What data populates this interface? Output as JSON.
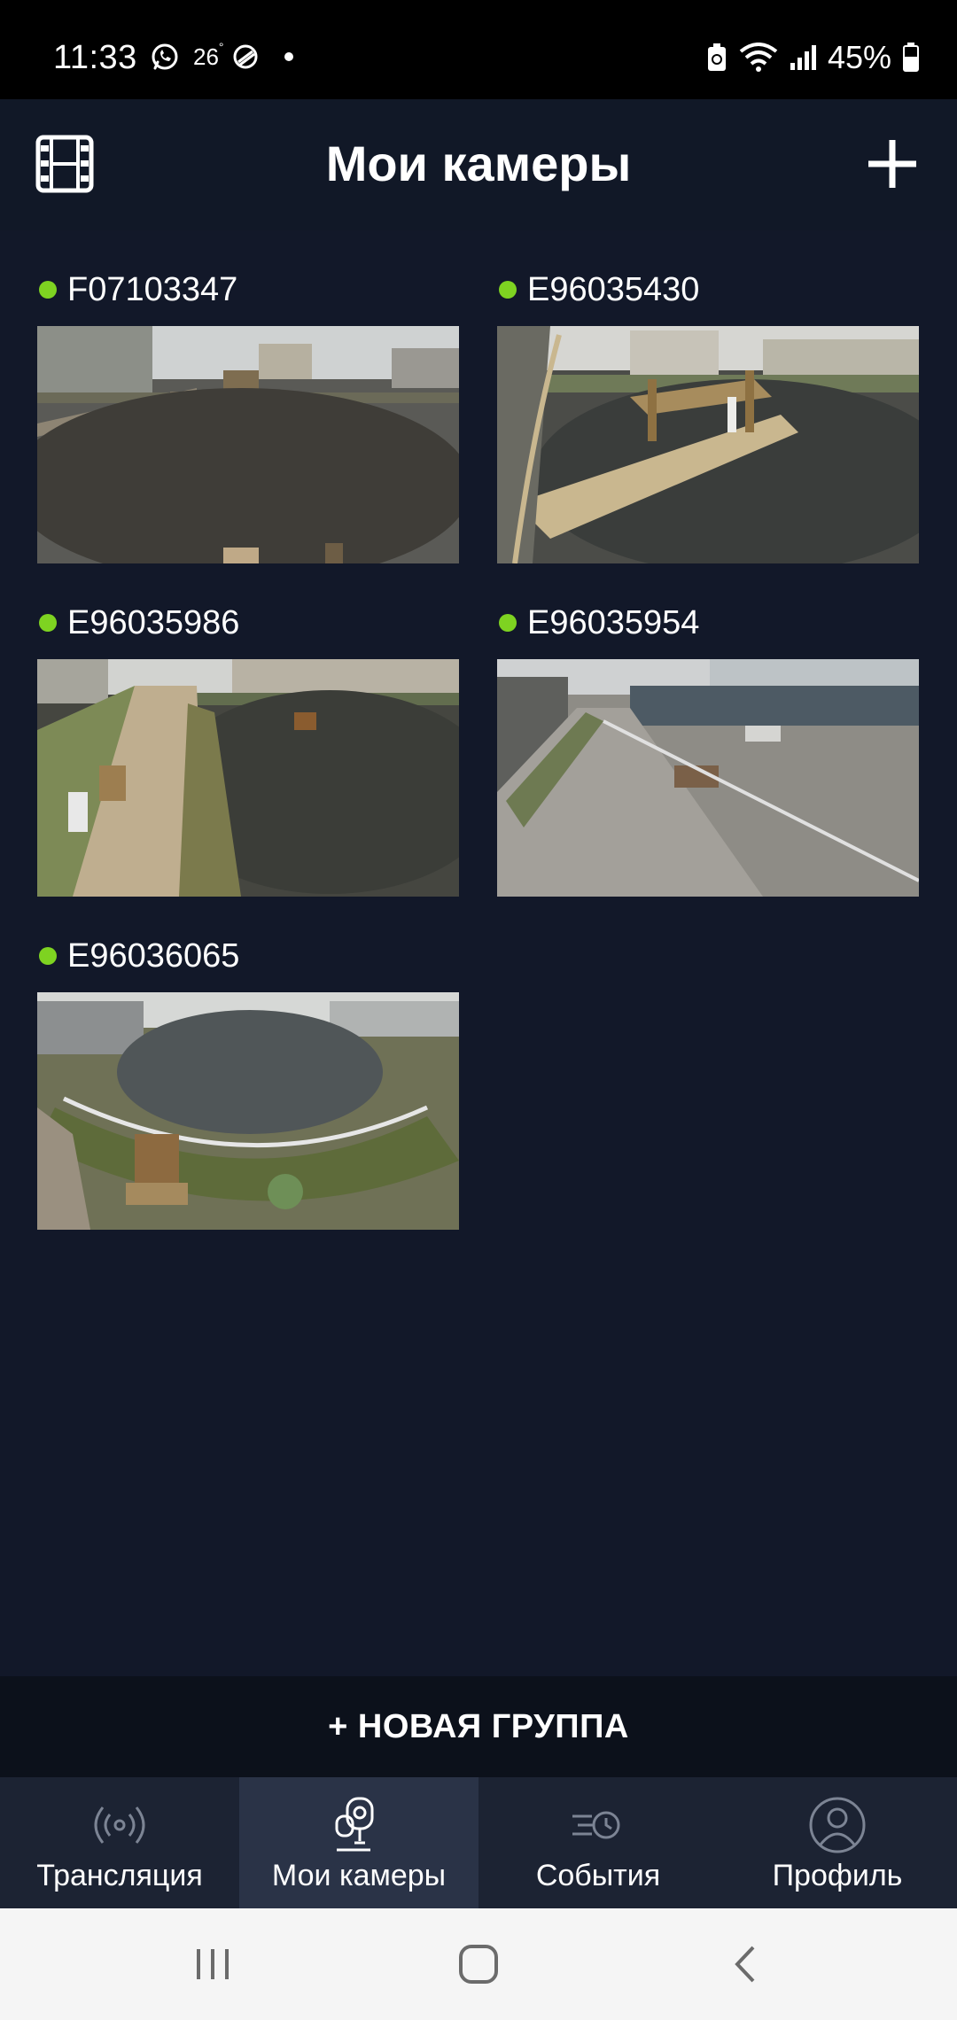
{
  "status_bar": {
    "time": "11:33",
    "temperature": "26",
    "temperature_unit": "°",
    "battery_pct": "45%"
  },
  "header": {
    "title": "Мои камеры"
  },
  "cameras": [
    {
      "name": "F07103347",
      "online": true
    },
    {
      "name": "E96035430",
      "online": true
    },
    {
      "name": "E96035986",
      "online": true
    },
    {
      "name": "E96035954",
      "online": true
    },
    {
      "name": "E96036065",
      "online": true
    }
  ],
  "new_group_label": "+ НОВАЯ ГРУППА",
  "bottom_nav": {
    "items": [
      {
        "label": "Трансляция",
        "icon": "broadcast-icon",
        "active": false
      },
      {
        "label": "Мои камеры",
        "icon": "camera-icon",
        "active": true
      },
      {
        "label": "События",
        "icon": "events-icon",
        "active": false
      },
      {
        "label": "Профиль",
        "icon": "profile-icon",
        "active": false
      }
    ]
  },
  "colors": {
    "background": "#121829",
    "status_online": "#7ed321",
    "nav_bg": "#1c2333",
    "nav_active_bg": "#2a3347"
  }
}
